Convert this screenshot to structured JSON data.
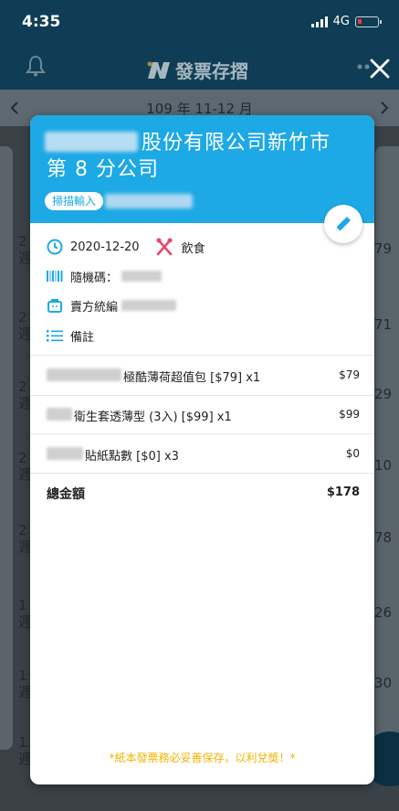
{
  "status": {
    "time": "4:35",
    "network": "4G"
  },
  "app": {
    "title": "發票存摺"
  },
  "period": {
    "label": "109 年 11-12 月"
  },
  "background_rows": [
    {
      "left_top": "2",
      "left_bottom": "週",
      "right": "79"
    },
    {
      "left_top": "2",
      "left_bottom": "週",
      "right": "71"
    },
    {
      "left_top": "2",
      "left_bottom": "週",
      "right": "29"
    },
    {
      "left_top": "2",
      "left_bottom": "週",
      "right": "10"
    },
    {
      "left_top": "2",
      "left_bottom": "週",
      "right": "78"
    },
    {
      "left_top": "1",
      "left_bottom": "週",
      "right": "26"
    },
    {
      "left_top": "1",
      "left_bottom": "週",
      "right": "30"
    },
    {
      "left_top": "1",
      "left_bottom": "週",
      "right": ""
    }
  ],
  "invoice": {
    "company_name": "股份有限公司新竹市第 8 分公司",
    "scan_badge": "掃描輸入",
    "date": "2020-12-20",
    "category": "飲食",
    "random_code_label": "隨機碼：",
    "seller_id_label": "賣方統編",
    "note_label": "備註",
    "items": [
      {
        "desc": "極酷薄荷超值包 [$79] x1",
        "price": "$79"
      },
      {
        "desc": "衛生套透薄型 (3入) [$99] x1",
        "price": "$99"
      },
      {
        "desc": "貼紙點數 [$0] x3",
        "price": "$0"
      }
    ],
    "total_label": "總金額",
    "total_value": "$178",
    "footer_note": "*紙本發票務必妥善保存，以利兌獎！*"
  },
  "colors": {
    "accent": "#1da8e6",
    "navy": "#0f3d55",
    "footer": "#f0b400"
  }
}
